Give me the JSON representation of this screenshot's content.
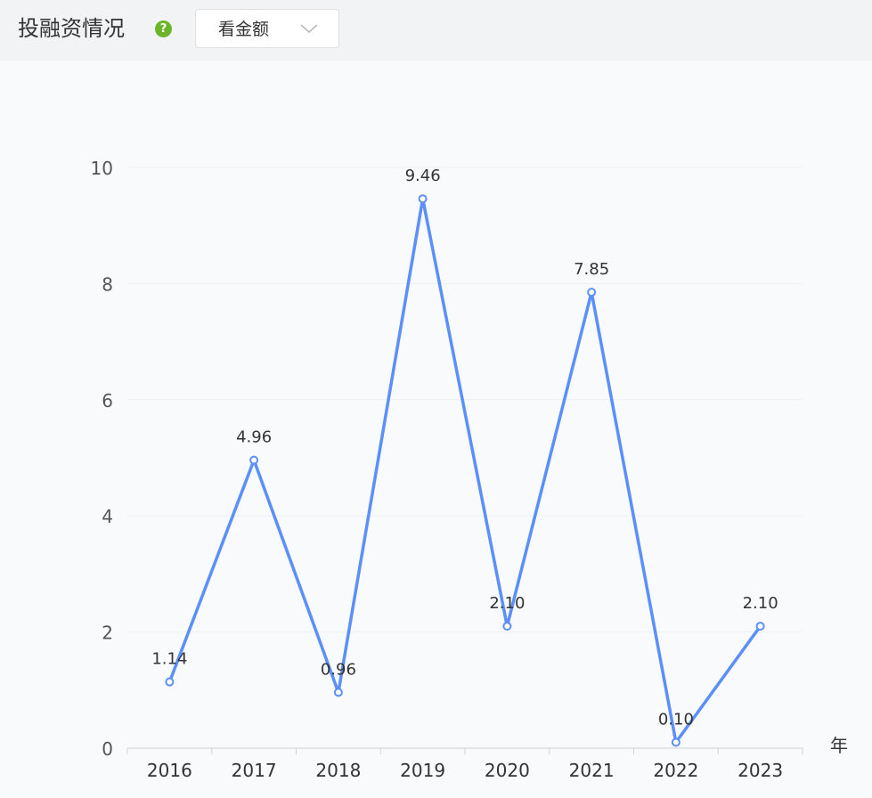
{
  "header": {
    "title": "投融资情况",
    "help_icon": "question-circle-icon",
    "dropdown": {
      "selected": "看金额",
      "icon": "chevron-down-icon"
    }
  },
  "colors": {
    "line": "#5b8ff9",
    "help_icon": "#6cb52a",
    "header_bg": "#f2f3f5",
    "chart_bg": "#f9fafc"
  },
  "chart_data": {
    "type": "line",
    "categories": [
      "2016",
      "2017",
      "2018",
      "2019",
      "2020",
      "2021",
      "2022",
      "2023"
    ],
    "values": [
      1.14,
      4.96,
      0.96,
      9.46,
      2.1,
      7.85,
      0.1,
      2.1
    ],
    "data_labels": [
      "1.14",
      "4.96",
      "0.96",
      "9.46",
      "2.10",
      "7.85",
      "0.10",
      "2.10"
    ],
    "ylim": [
      0,
      10
    ],
    "yticks": [
      "0",
      "2",
      "4",
      "6",
      "8",
      "10"
    ],
    "xlabel": "年",
    "ylabel": "",
    "grid": true,
    "legend": "none"
  }
}
